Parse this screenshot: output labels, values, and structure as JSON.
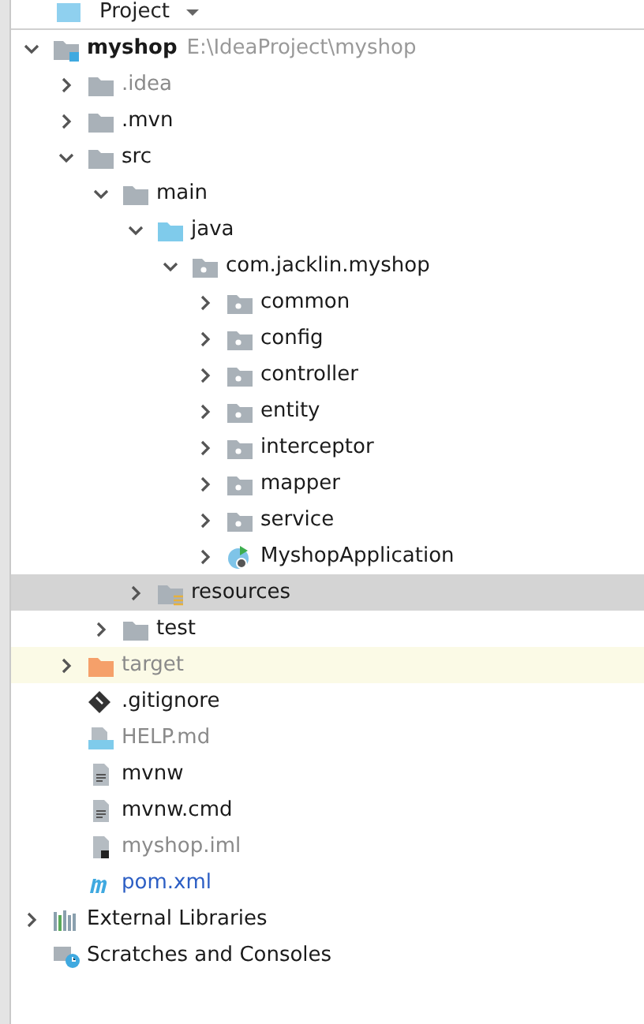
{
  "panel": {
    "title": "Project"
  },
  "tree": [
    {
      "label": "myshop",
      "kind": "module",
      "hint": "E:\\IdeaProject\\myshop",
      "expanded": true,
      "selected": false,
      "children": [
        {
          "label": ".idea",
          "kind": "folder",
          "dimmed": true,
          "expanded": false,
          "selected": false
        },
        {
          "label": ".mvn",
          "kind": "folder",
          "expanded": false,
          "selected": false
        },
        {
          "label": "src",
          "kind": "folder",
          "expanded": true,
          "selected": false,
          "children": [
            {
              "label": "main",
              "kind": "folder",
              "expanded": true,
              "selected": false,
              "children": [
                {
                  "label": "java",
                  "kind": "source-folder",
                  "expanded": true,
                  "selected": false,
                  "children": [
                    {
                      "label": "com.jacklin.myshop",
                      "kind": "package",
                      "expanded": true,
                      "selected": false,
                      "children": [
                        {
                          "label": "common",
                          "kind": "package",
                          "expanded": false,
                          "selected": false
                        },
                        {
                          "label": "config",
                          "kind": "package",
                          "expanded": false,
                          "selected": false
                        },
                        {
                          "label": "controller",
                          "kind": "package",
                          "expanded": false,
                          "selected": false
                        },
                        {
                          "label": "entity",
                          "kind": "package",
                          "expanded": false,
                          "selected": false
                        },
                        {
                          "label": "interceptor",
                          "kind": "package",
                          "expanded": false,
                          "selected": false
                        },
                        {
                          "label": "mapper",
                          "kind": "package",
                          "expanded": false,
                          "selected": false
                        },
                        {
                          "label": "service",
                          "kind": "package",
                          "expanded": false,
                          "selected": false
                        },
                        {
                          "label": "MyshopApplication",
                          "kind": "class",
                          "expanded": false,
                          "selected": false
                        }
                      ]
                    }
                  ]
                },
                {
                  "label": "resources",
                  "kind": "resources-folder",
                  "expanded": false,
                  "selected": true
                }
              ]
            },
            {
              "label": "test",
              "kind": "folder",
              "expanded": false,
              "selected": false
            }
          ]
        },
        {
          "label": "target",
          "kind": "excluded-folder",
          "dimmed": true,
          "expanded": false,
          "selected": false
        },
        {
          "label": ".gitignore",
          "kind": "git-file",
          "selected": false
        },
        {
          "label": "HELP.md",
          "kind": "markdown-file",
          "dimmed": true,
          "selected": false
        },
        {
          "label": "mvnw",
          "kind": "text-file",
          "selected": false
        },
        {
          "label": "mvnw.cmd",
          "kind": "text-file",
          "selected": false
        },
        {
          "label": "myshop.iml",
          "kind": "iml-file",
          "dimmed": true,
          "selected": false
        },
        {
          "label": "pom.xml",
          "kind": "maven-file",
          "modified": true,
          "selected": false
        }
      ]
    },
    {
      "label": "External Libraries",
      "kind": "libraries",
      "expanded": false,
      "selected": false
    },
    {
      "label": "Scratches and Consoles",
      "kind": "scratches",
      "selected": false
    }
  ]
}
